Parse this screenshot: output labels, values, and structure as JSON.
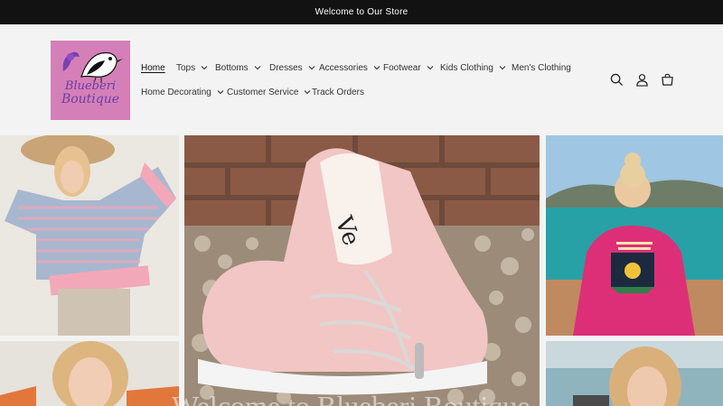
{
  "announcement": "Welcome to Our Store",
  "logo": {
    "line1": "Blueberi",
    "line2": "Boutique"
  },
  "nav": {
    "row1": [
      {
        "label": "Home",
        "dropdown": false,
        "active": true
      },
      {
        "label": "Tops",
        "dropdown": true
      },
      {
        "label": "Bottoms",
        "dropdown": true
      },
      {
        "label": "Dresses",
        "dropdown": true
      },
      {
        "label": "Accessories",
        "dropdown": true
      },
      {
        "label": "Footwear",
        "dropdown": true
      },
      {
        "label": "Kids Clothing",
        "dropdown": true
      },
      {
        "label": "Men's Clothing",
        "dropdown": false
      }
    ],
    "row2": [
      {
        "label": "Home Decorating",
        "dropdown": true
      },
      {
        "label": "Customer Service",
        "dropdown": true
      },
      {
        "label": "Track Orders",
        "dropdown": false
      }
    ]
  },
  "header_icons": [
    "search-icon",
    "account-icon",
    "cart-icon"
  ],
  "hero_caption": "Welcome to Blueberi Boutique",
  "colors": {
    "announce_bg": "#121212",
    "header_bg": "#f3f3f3",
    "logo_bg": "#d57fb8",
    "logo_text": "#6a3fa0"
  }
}
